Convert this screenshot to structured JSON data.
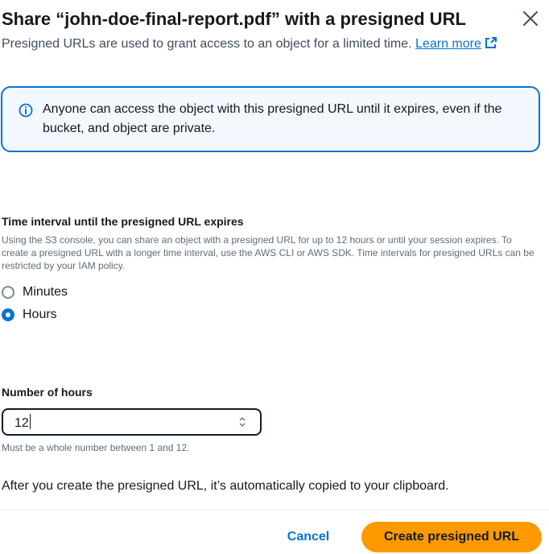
{
  "modal": {
    "title": "Share “john-doe-final-report.pdf” with a presigned URL",
    "description": "Presigned URLs are used to grant access to an object for a limited time.",
    "learn_more_label": "Learn more",
    "close_icon": "close-icon"
  },
  "alert": {
    "icon": "info-icon",
    "text": "Anyone can access the object with this presigned URL until it expires, even if the bucket, and object are private."
  },
  "time_interval": {
    "label": "Time interval until the presigned URL expires",
    "description": "Using the S3 console, you can share an object with a presigned URL for up to 12 hours or until your session expires. To create a presigned URL with a longer time interval, use the AWS CLI or AWS SDK. Time intervals for presigned URLs can be restricted by your IAM policy.",
    "options": [
      {
        "label": "Minutes",
        "selected": false
      },
      {
        "label": "Hours",
        "selected": true
      }
    ]
  },
  "hours_field": {
    "label": "Number of hours",
    "value": "12",
    "hint": "Must be a whole number between 1 and 12."
  },
  "footer": {
    "note": "After you create the presigned URL, it’s automatically copied to your clipboard.",
    "cancel_label": "Cancel",
    "create_label": "Create presigned URL"
  },
  "colors": {
    "link": "#0972d3",
    "primary_button": "#ff9900",
    "alert_border": "#0972d3",
    "alert_background": "#f2f8fd"
  }
}
